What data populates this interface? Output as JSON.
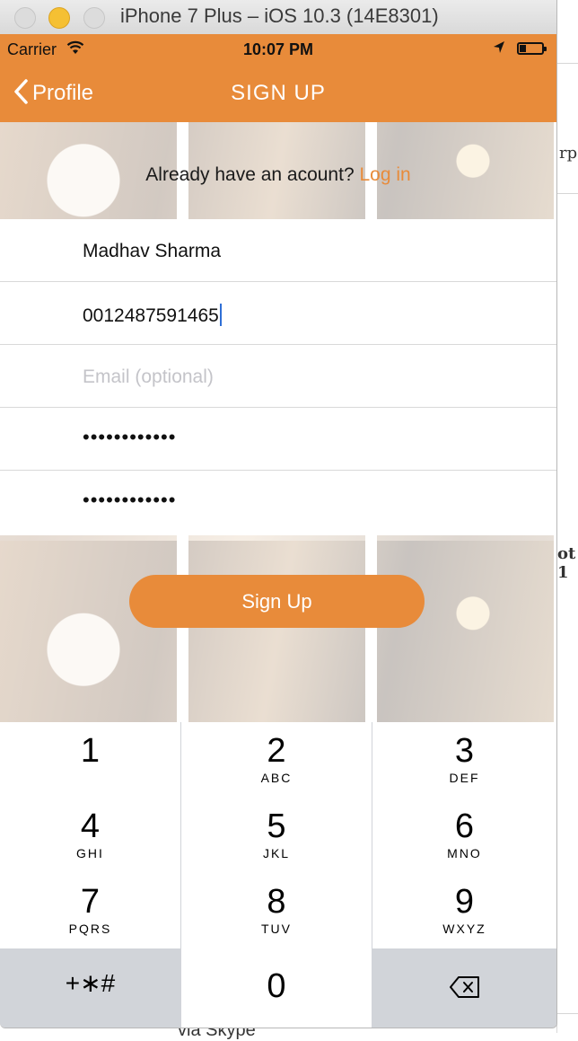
{
  "window": {
    "title": "iPhone 7 Plus – iOS 10.3 (14E8301)"
  },
  "background_window": {
    "fragment_top": "rpe",
    "fragment_mid": "ot 1",
    "fragment_bottom": "via Skype"
  },
  "status_bar": {
    "carrier": "Carrier",
    "time": "10:07 PM"
  },
  "nav": {
    "back_label": "Profile",
    "title": "SIGN UP"
  },
  "login_prompt": {
    "text": "Already have an acount?",
    "link": "Log in"
  },
  "form": {
    "name_value": "Madhav Sharma",
    "phone_value": "0012487591465",
    "email_placeholder": "Email (optional)",
    "password_masked": "••••••••••••",
    "confirm_password_masked": "••••••••••••"
  },
  "signup_button": {
    "label": "Sign Up"
  },
  "keypad": {
    "keys": [
      {
        "num": "1",
        "letters": ""
      },
      {
        "num": "2",
        "letters": "ABC"
      },
      {
        "num": "3",
        "letters": "DEF"
      },
      {
        "num": "4",
        "letters": "GHI"
      },
      {
        "num": "5",
        "letters": "JKL"
      },
      {
        "num": "6",
        "letters": "MNO"
      },
      {
        "num": "7",
        "letters": "PQRS"
      },
      {
        "num": "8",
        "letters": "TUV"
      },
      {
        "num": "9",
        "letters": "WXYZ"
      },
      {
        "num": "0",
        "letters": ""
      }
    ],
    "symbols_label": "+∗#"
  },
  "colors": {
    "accent": "#e88b3a",
    "caret": "#2f6fd6",
    "placeholder": "#c4c4c9"
  }
}
